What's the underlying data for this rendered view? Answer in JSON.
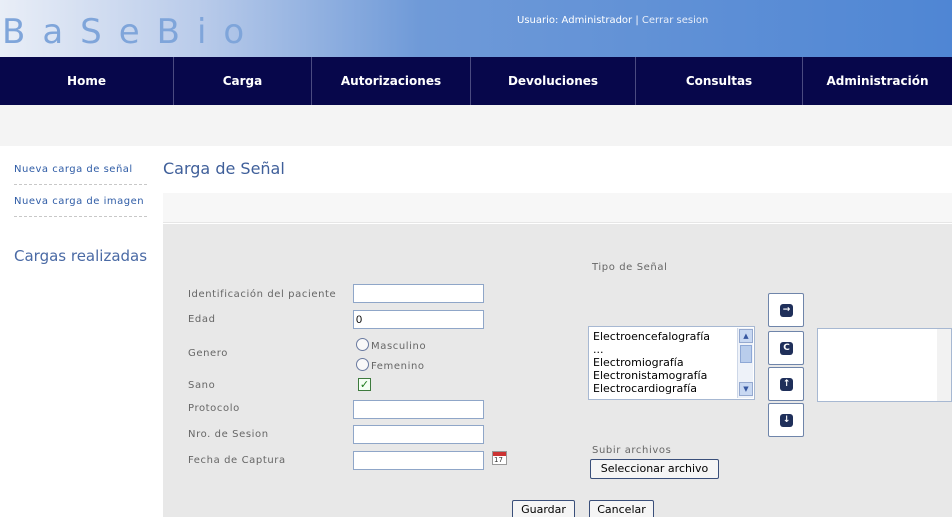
{
  "header": {
    "logo": "BaSeBio",
    "user_label": "Usuario: Administrador",
    "separator": "|",
    "logout": "Cerrar sesion"
  },
  "nav": [
    {
      "label": "Home"
    },
    {
      "label": "Carga"
    },
    {
      "label": "Autorizaciones"
    },
    {
      "label": "Devoluciones"
    },
    {
      "label": "Consultas"
    },
    {
      "label": "Administración"
    }
  ],
  "sidebar": {
    "links": [
      {
        "label": "Nueva carga de señal"
      },
      {
        "label": "Nueva carga de imagen"
      }
    ],
    "heading": "Cargas realizadas"
  },
  "page": {
    "title": "Carga de Señal"
  },
  "form": {
    "patient_id_label": "Identificación del paciente",
    "patient_id_value": "",
    "age_label": "Edad",
    "age_value": "0",
    "gender_label": "Genero",
    "gender_options": [
      "Masculino",
      "Femenino"
    ],
    "healthy_label": "Sano",
    "healthy_checked": true,
    "protocol_label": "Protocolo",
    "protocol_value": "",
    "session_label": "Nro. de Sesion",
    "session_value": "",
    "capture_date_label": "Fecha de Captura",
    "capture_date_value": "",
    "calendar_icon": "calendar-icon",
    "calendar_day": "17"
  },
  "signal": {
    "label": "Tipo de Señal",
    "options": [
      "Electroencefalografía",
      "...",
      "Electromiografía",
      "Electronistamografía",
      "Electrocardiografía"
    ],
    "move_buttons": [
      {
        "icon": "move-right-icon"
      },
      {
        "icon": "move-all-right-icon"
      },
      {
        "icon": "move-up-icon"
      },
      {
        "icon": "move-down-icon"
      }
    ]
  },
  "upload": {
    "label": "Subir archivos",
    "button": "Seleccionar archivo"
  },
  "actions": {
    "save": "Guardar",
    "cancel": "Cancelar"
  },
  "colors": {
    "nav_bg": "#07074b",
    "header_gradient_end": "#4f86d4",
    "form_bg": "#e8e8e8",
    "link": "#2f5ca6"
  }
}
